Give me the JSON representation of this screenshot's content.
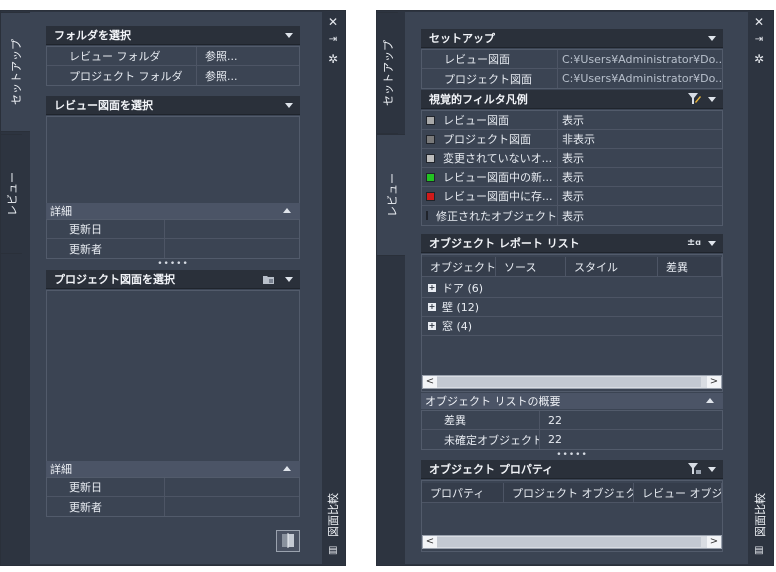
{
  "left": {
    "tabs": {
      "setup": "セットアップ",
      "review": "レビュー"
    },
    "folder_section": {
      "title": "フォルダを選択",
      "rows": [
        {
          "label": "レビュー フォルダ",
          "value": "参照..."
        },
        {
          "label": "プロジェクト フォルダ",
          "value": "参照..."
        }
      ]
    },
    "review_section": {
      "title": "レビュー図面を選択",
      "details_label": "詳細",
      "rows": [
        {
          "label": "更新日",
          "value": ""
        },
        {
          "label": "更新者",
          "value": ""
        }
      ]
    },
    "project_section": {
      "title": "プロジェクト図面を選択",
      "details_label": "詳細",
      "rows": [
        {
          "label": "更新日",
          "value": ""
        },
        {
          "label": "更新者",
          "value": ""
        }
      ]
    },
    "side_title": "図面比較"
  },
  "right": {
    "tabs": {
      "setup": "セットアップ",
      "review": "レビュー"
    },
    "setup_section": {
      "title": "セットアップ",
      "rows": [
        {
          "label": "レビュー図面",
          "value": "C:¥Users¥Administrator¥Do..."
        },
        {
          "label": "プロジェクト図面",
          "value": "C:¥Users¥Administrator¥Do..."
        }
      ]
    },
    "legend_section": {
      "title": "視覚的フィルタ凡例",
      "rows": [
        {
          "label": "レビュー図面",
          "value": "表示",
          "color": "#a9a9a9"
        },
        {
          "label": "プロジェクト図面",
          "value": "非表示",
          "color": "#7a7a7a"
        },
        {
          "label": "変更されていないオ...",
          "value": "表示",
          "color": "#bcbcbc"
        },
        {
          "label": "レビュー図面中の新...",
          "value": "表示",
          "color": "#22c322"
        },
        {
          "label": "レビュー図面中に存...",
          "value": "表示",
          "color": "#d01a1a"
        },
        {
          "label": "修正されたオブジェクト",
          "value": "表示",
          "color": "#e8d41a"
        }
      ]
    },
    "report_section": {
      "title": "オブジェクト レポート リスト",
      "columns": [
        "オブジェクト",
        "ソース",
        "スタイル",
        "差異"
      ],
      "tree": [
        "ドア (6)",
        "壁 (12)",
        "窓 (4)"
      ]
    },
    "summary_section": {
      "title": "オブジェクト リストの概要",
      "rows": [
        {
          "label": "差異",
          "value": "22"
        },
        {
          "label": "未確定オブジェクト",
          "value": "22"
        }
      ]
    },
    "props_section": {
      "title": "オブジェクト プロパティ",
      "columns": [
        "プロパティ",
        "プロジェクト オブジェクト",
        "レビュー オブジェ..."
      ]
    },
    "side_title": "図面比較"
  }
}
